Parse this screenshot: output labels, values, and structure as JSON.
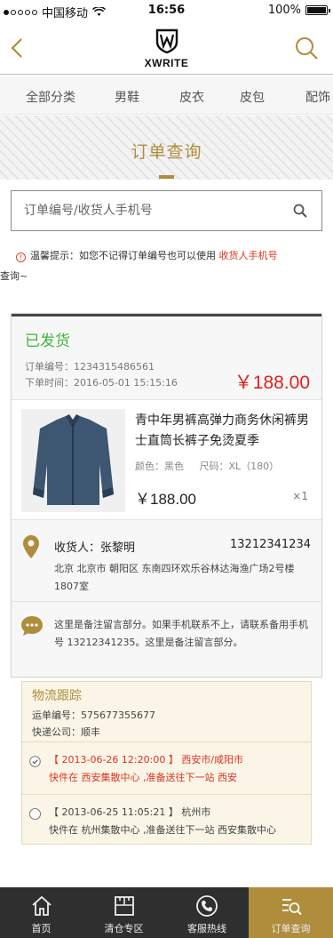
{
  "status_bar": {
    "carrier": "中国移动",
    "time": "16:56",
    "battery": "100%"
  },
  "header": {
    "logo_text": "XWRITE"
  },
  "categories": [
    "全部分类",
    "男鞋",
    "皮衣",
    "皮包",
    "配饰"
  ],
  "banner": {
    "title": "订单查询"
  },
  "search": {
    "placeholder": "订单编号/收货人手机号"
  },
  "tip": {
    "text_before": "温馨提示：如您不记得订单编号也可以使用 ",
    "highlight": "收货人手机号",
    "text_after": "查询~"
  },
  "order": {
    "status": "已发货",
    "order_no_label": "订单编号：",
    "order_no": "1234315486561",
    "time_label": "下单时间：",
    "time": "2016-05-01 15:15:16",
    "total": "￥188.00",
    "product": {
      "name": "青中年男裤高弹力商务休闲裤男士直筒长裤子免烫夏季",
      "color": "颜色：黑色",
      "size": "尺码：XL（180）",
      "price": "￥188.00",
      "qty": "×1"
    },
    "receiver": {
      "name": "收货人：张黎明",
      "phone": "13212341234",
      "address": "北京  北京市 朝阳区 东南四环欢乐谷林达海渔广场2号楼1807室"
    },
    "message": "这里是备注留言部分。如果手机联系不上，请联系备用手机号 13212341235。这里是备注留言部分。"
  },
  "logistics": {
    "title": "物流跟踪",
    "tracking": "运单编号：575677355677",
    "company": "快递公司：顺丰",
    "steps": [
      {
        "time": "【 2013-06-26 12:20:00 】  西安市/咸阳市",
        "detail": "快件在 西安集散中心 ,准备送往下一站 西安"
      },
      {
        "time": "【 2013-06-25 11:05:21 】  杭州市",
        "detail": "快件在 杭州集散中心 ,准备送往下一站 西安集散中心"
      }
    ]
  },
  "tabbar": [
    "首页",
    "清仓专区",
    "客服热线",
    "订单查询"
  ],
  "colors": {
    "accent": "#b08d3c",
    "red": "#e0221d",
    "green": "#3fb63a"
  },
  "icons": [
    "back-icon",
    "search-icon",
    "warning-icon",
    "location-icon",
    "chat-icon",
    "home-icon",
    "grid-icon",
    "phone-icon",
    "order-search-icon"
  ]
}
